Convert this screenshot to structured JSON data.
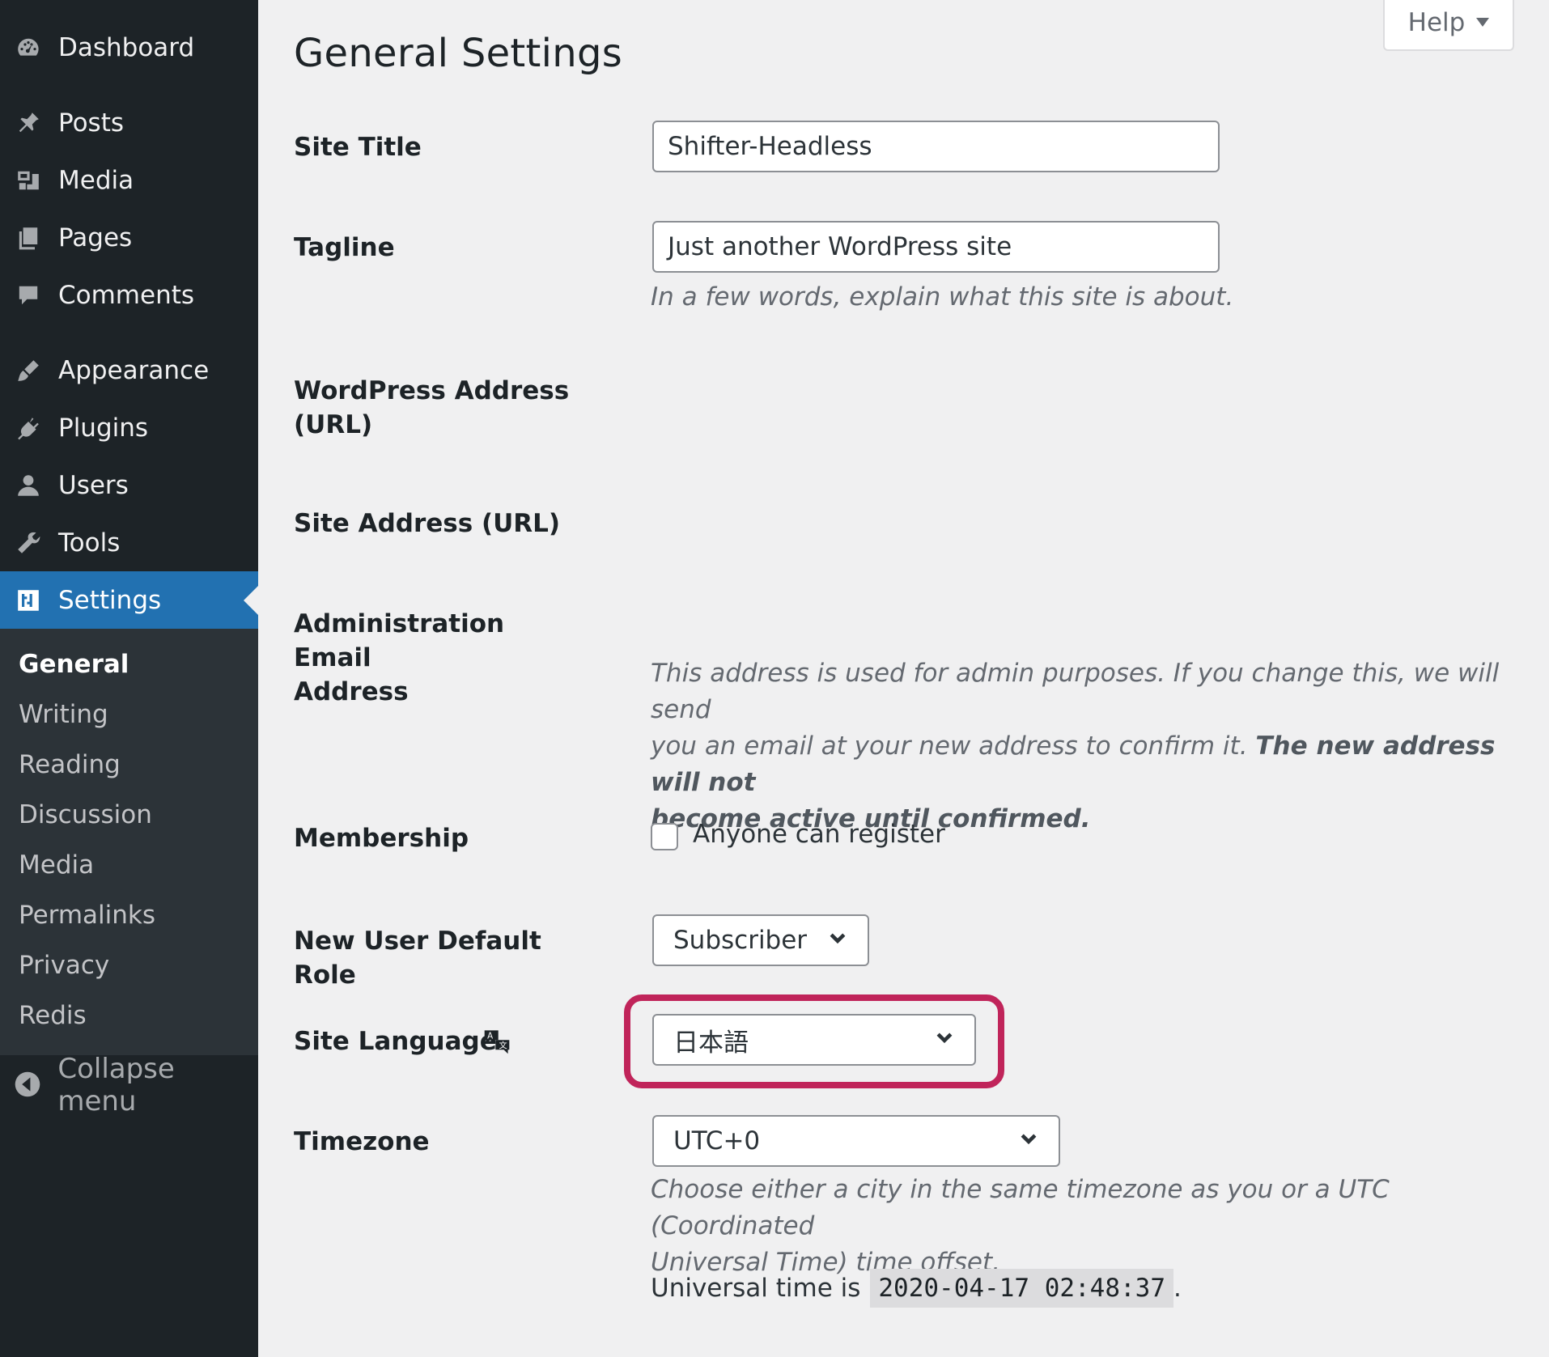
{
  "sidebar": {
    "items": [
      {
        "label": "Dashboard",
        "icon": "dashboard-icon"
      },
      {
        "label": "Posts",
        "icon": "pin-icon"
      },
      {
        "label": "Media",
        "icon": "media-icon"
      },
      {
        "label": "Pages",
        "icon": "pages-icon"
      },
      {
        "label": "Comments",
        "icon": "comment-icon"
      },
      {
        "label": "Appearance",
        "icon": "brush-icon"
      },
      {
        "label": "Plugins",
        "icon": "plugin-icon"
      },
      {
        "label": "Users",
        "icon": "user-icon"
      },
      {
        "label": "Tools",
        "icon": "wrench-icon"
      },
      {
        "label": "Settings",
        "icon": "settings-icon",
        "current": true
      }
    ],
    "submenu": [
      "General",
      "Writing",
      "Reading",
      "Discussion",
      "Media",
      "Permalinks",
      "Privacy",
      "Redis"
    ],
    "submenu_current": "General",
    "collapse_label": "Collapse menu",
    "accent_color": "#2271b1"
  },
  "header": {
    "help_label": "Help",
    "page_title": "General Settings"
  },
  "form": {
    "site_title": {
      "label": "Site Title",
      "value": "Shifter-Headless"
    },
    "tagline": {
      "label": "Tagline",
      "value": "Just another WordPress site",
      "description": "In a few words, explain what this site is about."
    },
    "wp_address": {
      "label_line1": "WordPress Address",
      "label_line2": "(URL)"
    },
    "site_address": {
      "label": "Site Address (URL)"
    },
    "admin_email": {
      "label_line1": "Administration Email",
      "label_line2": "Address",
      "description_line1": "This address is used for admin purposes. If you change this, we will send",
      "description_line2_a": "you an email at your new address to confirm it. ",
      "description_line2_b": "The new address will not",
      "description_line3": "become active until confirmed."
    },
    "membership": {
      "label": "Membership",
      "checkbox_label": "Anyone can register",
      "checked": false
    },
    "default_role": {
      "label": "New User Default Role",
      "value": "Subscriber"
    },
    "site_language": {
      "label": "Site Language",
      "value": "日本語",
      "highlight_color": "#c0245a"
    },
    "timezone": {
      "label": "Timezone",
      "value": "UTC+0",
      "description_line1": "Choose either a city in the same timezone as you or a UTC (Coordinated",
      "description_line2": "Universal Time) time offset.",
      "universal_prefix": "Universal time is",
      "universal_time": "2020-04-17 02:48:37",
      "universal_suffix": "."
    }
  }
}
